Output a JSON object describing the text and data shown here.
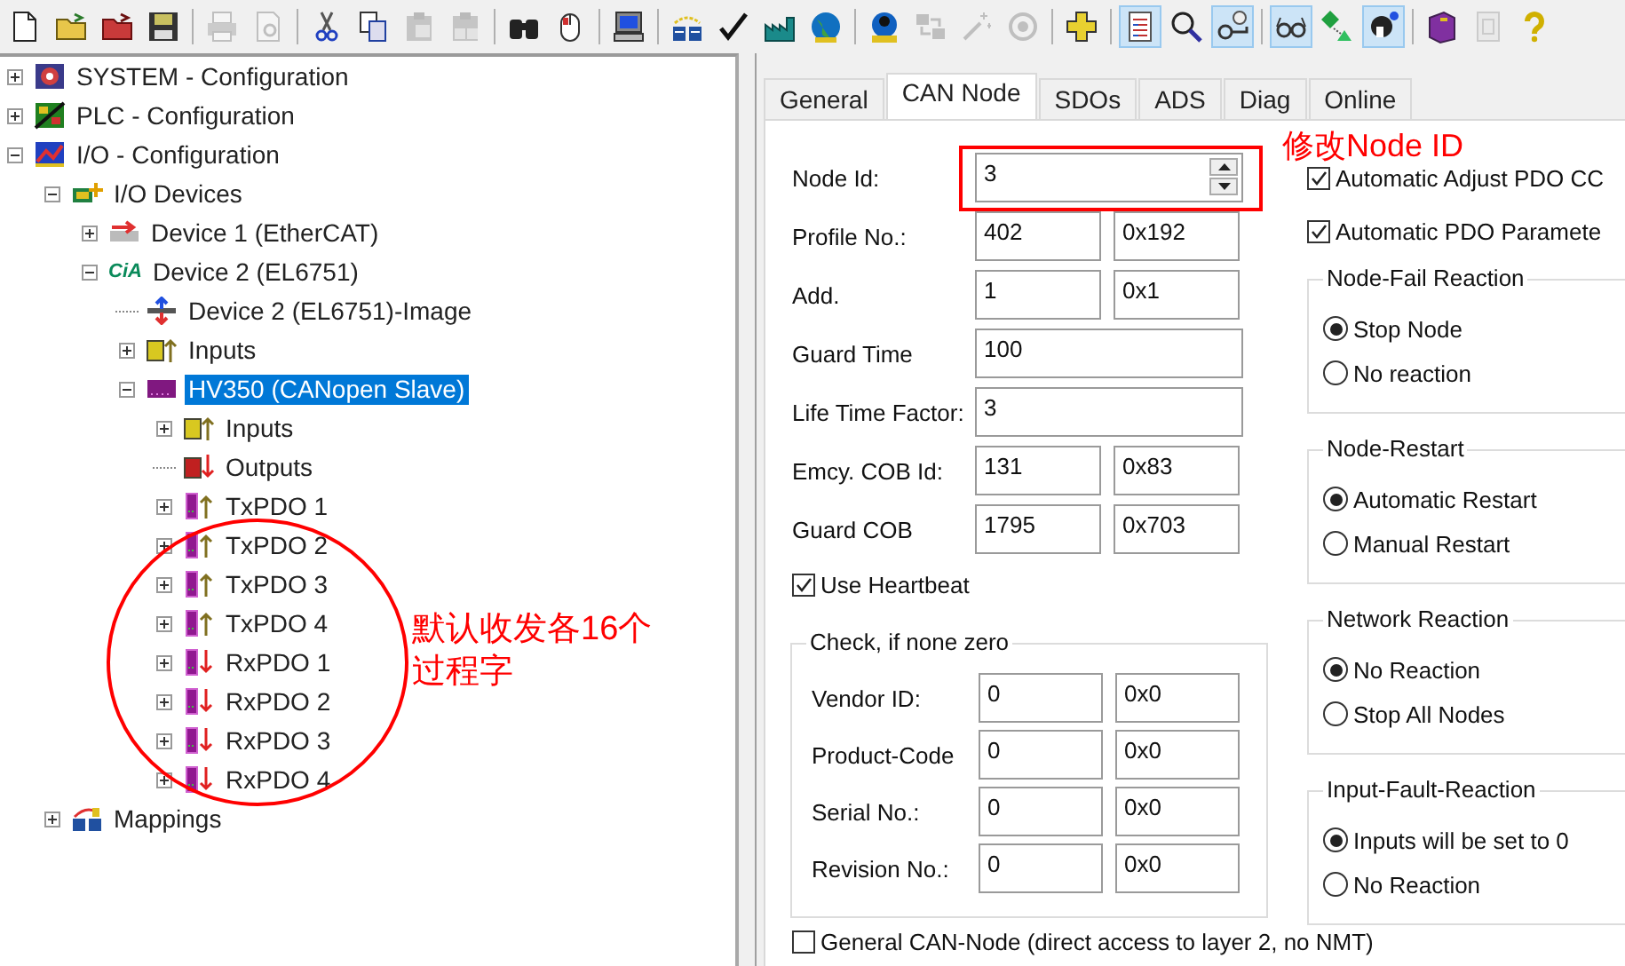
{
  "toolbar": {
    "groups": [
      [
        {
          "disabled": false,
          "pressed": false
        },
        {
          "disabled": false,
          "pressed": false
        },
        {
          "disabled": false,
          "pressed": false
        },
        {
          "disabled": false,
          "pressed": false
        }
      ],
      [
        {
          "disabled": true,
          "pressed": false
        },
        {
          "disabled": true,
          "pressed": false
        }
      ],
      [
        {
          "disabled": false,
          "pressed": false
        },
        {
          "disabled": false,
          "pressed": false
        },
        {
          "disabled": true,
          "pressed": false
        },
        {
          "disabled": true,
          "pressed": false
        }
      ],
      [
        {
          "disabled": false,
          "pressed": false
        },
        {
          "disabled": false,
          "pressed": false
        }
      ],
      [
        {
          "disabled": false,
          "pressed": false
        }
      ],
      [
        {
          "disabled": false,
          "pressed": false
        },
        {
          "disabled": false,
          "pressed": false
        },
        {
          "disabled": false,
          "pressed": false
        },
        {
          "disabled": false,
          "pressed": false
        }
      ],
      [
        {
          "disabled": false,
          "pressed": false
        },
        {
          "disabled": true,
          "pressed": false
        },
        {
          "disabled": true,
          "pressed": false
        },
        {
          "disabled": true,
          "pressed": false
        }
      ],
      [
        {
          "disabled": false,
          "pressed": false
        }
      ],
      [
        {
          "disabled": false,
          "pressed": true
        },
        {
          "disabled": false,
          "pressed": false
        },
        {
          "disabled": false,
          "pressed": true
        }
      ],
      [
        {
          "disabled": false,
          "pressed": true
        },
        {
          "disabled": false,
          "pressed": false
        },
        {
          "disabled": false,
          "pressed": true
        }
      ],
      [
        {
          "disabled": false,
          "pressed": false
        },
        {
          "disabled": true,
          "pressed": false
        },
        {
          "disabled": false,
          "pressed": false
        }
      ]
    ]
  },
  "tree": {
    "nodes": [
      {
        "label": "SYSTEM - Configuration",
        "kind": "system",
        "expanded": false,
        "selected": false
      },
      {
        "label": "PLC - Configuration",
        "kind": "plc",
        "expanded": false,
        "selected": false
      },
      {
        "label": "I/O - Configuration",
        "kind": "io",
        "expanded": true,
        "selected": false,
        "children": [
          {
            "label": "I/O Devices",
            "kind": "devices",
            "expanded": true,
            "selected": false,
            "children": [
              {
                "label": "Device 1 (EtherCAT)",
                "kind": "ethercat",
                "expanded": false,
                "selected": false
              },
              {
                "label": "Device 2 (EL6751)",
                "kind": "cia",
                "badge": "CiA",
                "expanded": true,
                "selected": false,
                "children": [
                  {
                    "label": "Device 2 (EL6751)-Image",
                    "kind": "image",
                    "selected": false
                  },
                  {
                    "label": "Inputs",
                    "kind": "inputs",
                    "expanded": false,
                    "selected": false
                  },
                  {
                    "label": "HV350 (CANopen Slave)",
                    "kind": "slave",
                    "expanded": true,
                    "selected": true,
                    "children": [
                      {
                        "label": "Inputs",
                        "kind": "inputs",
                        "expanded": false,
                        "selected": false
                      },
                      {
                        "label": "Outputs",
                        "kind": "outputs",
                        "selected": false
                      },
                      {
                        "label": "TxPDO 1",
                        "kind": "txpdo",
                        "expanded": false,
                        "selected": false
                      },
                      {
                        "label": "TxPDO 2",
                        "kind": "txpdo",
                        "expanded": false,
                        "selected": false
                      },
                      {
                        "label": "TxPDO 3",
                        "kind": "txpdo",
                        "expanded": false,
                        "selected": false
                      },
                      {
                        "label": "TxPDO 4",
                        "kind": "txpdo",
                        "expanded": false,
                        "selected": false
                      },
                      {
                        "label": "RxPDO 1",
                        "kind": "rxpdo",
                        "expanded": false,
                        "selected": false
                      },
                      {
                        "label": "RxPDO 2",
                        "kind": "rxpdo",
                        "expanded": false,
                        "selected": false
                      },
                      {
                        "label": "RxPDO 3",
                        "kind": "rxpdo",
                        "expanded": false,
                        "selected": false
                      },
                      {
                        "label": "RxPDO 4",
                        "kind": "rxpdo",
                        "expanded": false,
                        "selected": false
                      }
                    ]
                  }
                ]
              }
            ]
          },
          {
            "label": "Mappings",
            "kind": "mappings",
            "expanded": false,
            "selected": false
          }
        ]
      }
    ]
  },
  "tabs": [
    {
      "label": "General",
      "selected": false
    },
    {
      "label": "CAN Node",
      "selected": true
    },
    {
      "label": "SDOs",
      "selected": false
    },
    {
      "label": "ADS",
      "selected": false
    },
    {
      "label": "Diag",
      "selected": false
    },
    {
      "label": "Online",
      "selected": false
    }
  ],
  "can_node": {
    "node_id": {
      "label": "Node Id:",
      "value": "3"
    },
    "rows": [
      {
        "label": "Profile No.:",
        "value": "402",
        "hex": "0x192"
      },
      {
        "label": "Add.",
        "value": "1",
        "hex": "0x1"
      },
      {
        "label": "Guard Time",
        "value": "100"
      },
      {
        "label": "Life Time Factor:",
        "value": "3"
      },
      {
        "label": "Emcy. COB Id:",
        "value": "131",
        "hex": "0x83"
      },
      {
        "label": "Guard COB",
        "value": "1795",
        "hex": "0x703"
      }
    ],
    "use_heartbeat": {
      "label": "Use Heartbeat",
      "checked": true
    },
    "check_group": {
      "title": "Check, if none zero",
      "rows": [
        {
          "label": "Vendor ID:",
          "value": "0",
          "hex": "0x0"
        },
        {
          "label": "Product-Code",
          "value": "0",
          "hex": "0x0"
        },
        {
          "label": "Serial No.:",
          "value": "0",
          "hex": "0x0"
        },
        {
          "label": "Revision No.:",
          "value": "0",
          "hex": "0x0"
        }
      ]
    },
    "general_can_node": {
      "label": "General CAN-Node (direct access to layer 2, no NMT)",
      "checked": false
    },
    "options": [
      {
        "label": "Automatic Adjust PDO CC",
        "checked": true
      },
      {
        "label": "Automatic PDO Paramete",
        "checked": true
      }
    ],
    "reaction_groups": [
      {
        "title": "Node-Fail Reaction",
        "choices": [
          {
            "label": "Stop Node",
            "selected": true
          },
          {
            "label": "No reaction",
            "selected": false
          }
        ]
      },
      {
        "title": "Node-Restart",
        "choices": [
          {
            "label": "Automatic Restart",
            "selected": true
          },
          {
            "label": "Manual Restart",
            "selected": false
          }
        ]
      },
      {
        "title": "Network Reaction",
        "choices": [
          {
            "label": "No Reaction",
            "selected": true
          },
          {
            "label": "Stop All Nodes",
            "selected": false
          }
        ]
      },
      {
        "title": "Input-Fault-Reaction",
        "choices": [
          {
            "label": "Inputs will be set to 0",
            "selected": true
          },
          {
            "label": "No Reaction",
            "selected": false
          }
        ]
      }
    ]
  },
  "annotations": {
    "node_id_note": "修改Node ID",
    "pdo_note": "默认收发各16个过程字"
  }
}
